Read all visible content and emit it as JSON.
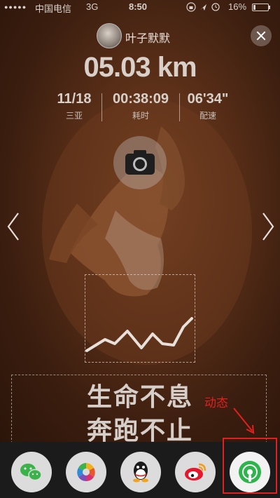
{
  "status_bar": {
    "signal": "●●●●●",
    "carrier": "中国电信",
    "network": "3G",
    "time": "8:50",
    "icons": "lock ➤ ⏰",
    "battery_percent": "16%"
  },
  "user": {
    "name": "叶子默默"
  },
  "run": {
    "distance": "05.03 km",
    "stats": [
      {
        "value": "11/18",
        "label": "三亚"
      },
      {
        "value": "00:38:09",
        "label": "耗时"
      },
      {
        "value": "06'34\"",
        "label": "配速"
      }
    ]
  },
  "slogan": {
    "line1": "生命不息",
    "line2": "奔跑不止"
  },
  "annotation": {
    "label": "动态",
    "color": "#e41f1f"
  },
  "share_bar": {
    "items": [
      {
        "icon": "wechat-icon"
      },
      {
        "icon": "moments-icon"
      },
      {
        "icon": "qq-icon"
      },
      {
        "icon": "weibo-icon"
      },
      {
        "icon": "feed-icon"
      }
    ],
    "accent": "#2db44a"
  }
}
